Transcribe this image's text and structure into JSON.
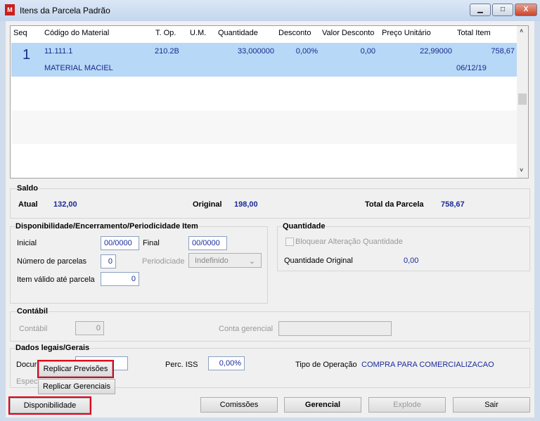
{
  "window": {
    "title": "Itens da Parcela Padrão",
    "icon": "app-logo-icon",
    "minimize": "▁",
    "maximize": "□",
    "close": "X"
  },
  "grid": {
    "headers": [
      "Seq",
      "Código do Material",
      "T. Op.",
      "U.M.",
      "Quantidade",
      "Desconto",
      "Valor Desconto",
      "Preço Unitário",
      "Total Item"
    ],
    "rows": [
      {
        "seq": "1",
        "codigo": "11.111.1",
        "top": "210.2B",
        "um": "",
        "quantidade": "33,000000",
        "desconto": "0,00%",
        "valor_desconto": "0,00",
        "preco": "22,99000",
        "total": "758,67",
        "descricao": "MATERIAL MACIEL",
        "data": "06/12/19"
      }
    ]
  },
  "saldo": {
    "title": "Saldo",
    "atual_label": "Atual",
    "atual": "132,00",
    "original_label": "Original",
    "original": "198,00",
    "total_label": "Total da Parcela",
    "total": "758,67"
  },
  "disp": {
    "title": "Disponibilidade/Encerramento/Periodicidade Item",
    "inicial_label": "Inicial",
    "inicial": "00/0000",
    "final_label": "Final",
    "final": "00/0000",
    "parcelas_label": "Número de parcelas",
    "parcelas": "0",
    "periodicidade_label": "Periodiciade",
    "periodicidade": "Indefinido",
    "valido_label": "Item válido até parcela",
    "valido": "0"
  },
  "quantidade": {
    "title": "Quantidade",
    "bloquear_label": "Bloquear Alteração Quantidade",
    "original_label": "Quantidade Original",
    "original": "0,00"
  },
  "contabil": {
    "title": "Contábil",
    "contabil_label": "Contábil",
    "contabil": "0",
    "gerencial_label": "Conta gerencial",
    "gerencial": ""
  },
  "dados": {
    "title": "Dados legais/Gerais",
    "doc_label": "Docur",
    "espec_label": "Espec",
    "iss_label": "Perc. ISS",
    "iss": "0,00%",
    "tipo_label": "Tipo de Operação",
    "tipo": "COMPRA PARA COMERCIALIZACAO"
  },
  "popup": {
    "replicar_previsoes": "Replicar Previsões",
    "replicar_gerenciais": "Replicar Gerenciais"
  },
  "buttons": {
    "disponibilidade": "Disponibilidade",
    "comissoes": "Comissões",
    "gerencial": "Gerencial",
    "explode": "Explode",
    "sair": "Sair"
  }
}
